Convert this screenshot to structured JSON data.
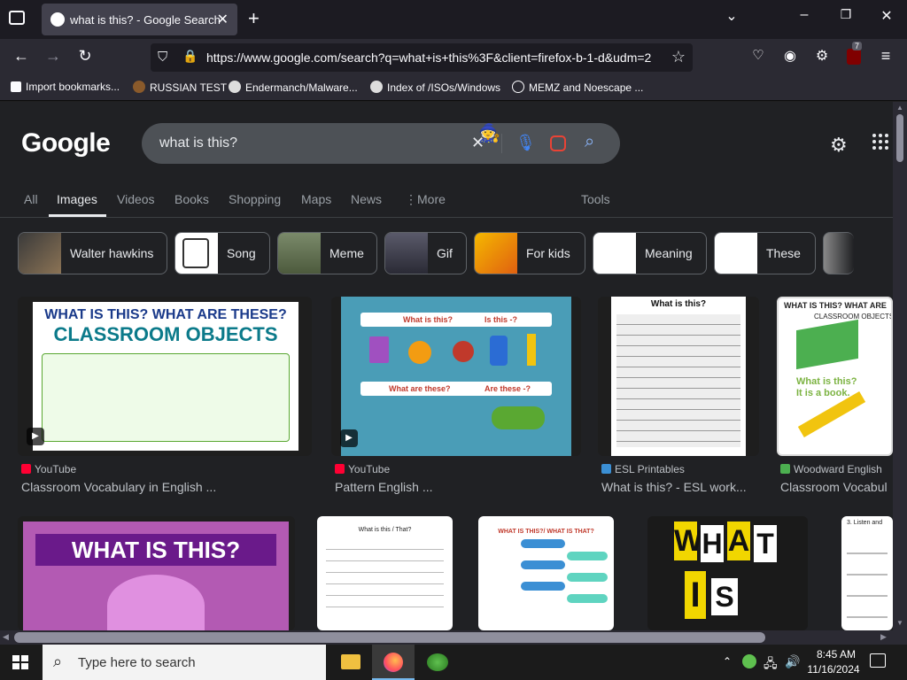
{
  "browser": {
    "tab_title": "what is this? - Google Search",
    "url": "https://www.google.com/search?q=what+is+this%3F&client=firefox-b-1-d&udm=2",
    "extension_badge": "7",
    "bookmarks": [
      {
        "label": "Import bookmarks..."
      },
      {
        "label": "RUSSIAN TEST"
      },
      {
        "label": "Endermanch/Malware..."
      },
      {
        "label": "Index of /ISOs/Windows"
      },
      {
        "label": "MEMZ and Noescape ..."
      }
    ]
  },
  "google": {
    "logo": "Google",
    "query": "what is this?",
    "tabs": [
      "All",
      "Images",
      "Videos",
      "Books",
      "Shopping",
      "Maps",
      "News",
      "More",
      "Tools"
    ],
    "active_tab": "Images",
    "chips": [
      "Walter hawkins",
      "Song",
      "Meme",
      "Gif",
      "For kids",
      "Meaning",
      "These"
    ],
    "results_row1": [
      {
        "source": "YouTube",
        "caption": "Classroom Vocabulary in English ...",
        "img_title": "WHAT IS THIS? WHAT ARE THESE?",
        "img_sub": "CLASSROOM OBJECTS"
      },
      {
        "source": "YouTube",
        "caption": "Pattern English ...",
        "img_q1": "What is this?",
        "img_q2": "Is this -?",
        "img_q3": "What are these?",
        "img_q4": "Are these -?"
      },
      {
        "source": "ESL Printables",
        "caption": "What is this? - ESL work...",
        "img_title": "What is this?"
      },
      {
        "source": "Woodward English",
        "caption": "Classroom Vocabul",
        "img_title": "WHAT IS THIS? WHAT ARE",
        "img_sub": "CLASSROOM OBJECTS",
        "img_line1": "What is this?",
        "img_line2": "It is a book."
      }
    ],
    "results_row2": [
      {
        "img_title": "WHAT IS THIS?"
      },
      {
        "img_title": "What is this / That?"
      },
      {
        "img_title": "WHAT IS THIS?/ WHAT IS THAT?"
      },
      {
        "img_letters": [
          "W",
          "H",
          "A",
          "T",
          "I",
          "S"
        ]
      },
      {
        "img_title": "3. Listen and"
      }
    ]
  },
  "taskbar": {
    "search_placeholder": "Type here to search",
    "time": "8:45 AM",
    "date": "11/16/2024"
  },
  "colors": {
    "page_bg": "#202124",
    "chrome_bg": "#2b2a33",
    "tab_strip_bg": "#1c1b22",
    "search_box": "#4d5156",
    "accent_blue": "#1a73e8"
  }
}
